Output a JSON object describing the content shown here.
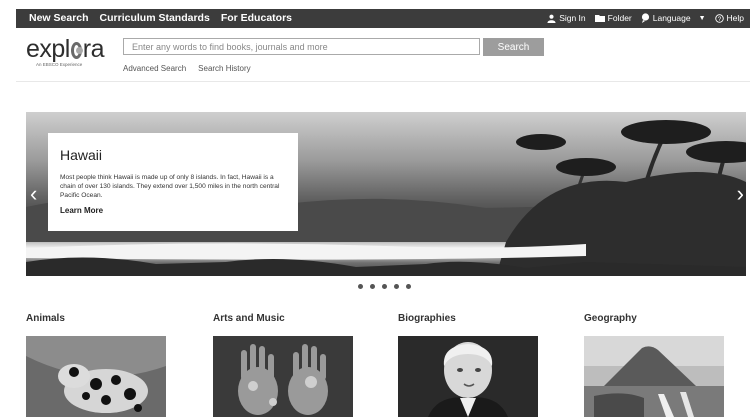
{
  "topnav": {
    "items": [
      "New Search",
      "Curriculum Standards",
      "For Educators"
    ]
  },
  "utility": {
    "sign_in": "Sign In",
    "folder": "Folder",
    "language": "Language",
    "help": "Help"
  },
  "logo": {
    "text_before": "expl",
    "text_after": "ra",
    "tagline": "An EBSCO Experience"
  },
  "search": {
    "placeholder": "Enter any words to find books, journals and more",
    "value": "",
    "button_label": "Search",
    "advanced": "Advanced Search",
    "history": "Search History"
  },
  "hero": {
    "title": "Hawaii",
    "description": "Most people think Hawaii is made up of only 8 islands. In fact, Hawaii is a chain of over 130 islands. They extend over 1,500 miles in the north central Pacific Ocean.",
    "link": "Learn More",
    "prev_arrow": "‹",
    "next_arrow": "›",
    "slide_count": 5
  },
  "categories": [
    {
      "label": "Animals"
    },
    {
      "label": "Arts and Music"
    },
    {
      "label": "Biographies"
    },
    {
      "label": "Geography"
    }
  ],
  "colors": {
    "topbar": "#3c3c3c",
    "search_button": "#9d9d9d"
  }
}
